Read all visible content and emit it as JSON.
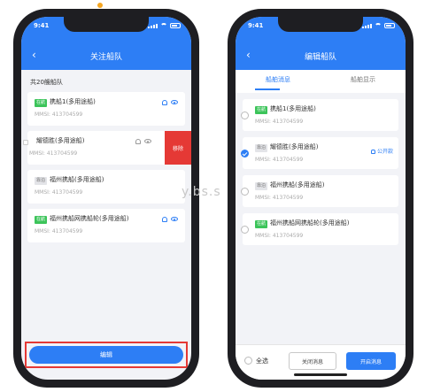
{
  "watermark": "y.bs.s",
  "left_phone": {
    "time": "9:41",
    "title": "关注船队",
    "count_text": "共20艘船队",
    "vessels": [
      {
        "tag": "在航",
        "tag_color": "green",
        "name": "携船1(多用途船)",
        "mmsi": "MMSI: 413704599"
      },
      {
        "tag": "",
        "tag_color": "box",
        "name": "耀德胜(多用途船)",
        "mmsi": "MMSI: 413704599",
        "action": "移除"
      },
      {
        "tag": "靠泊",
        "tag_color": "gray",
        "name": "福州携船(多用途船)",
        "mmsi": "MMSI: 413704599"
      },
      {
        "tag": "在航",
        "tag_color": "green",
        "name": "福州携船网携船轮(多用途船)",
        "mmsi": "MMSI: 413704599"
      }
    ],
    "edit_button": "编辑"
  },
  "right_phone": {
    "time": "9:41",
    "title": "编辑船队",
    "tabs": [
      "船舶消息",
      "船舶显示"
    ],
    "active_tab": 0,
    "vessels": [
      {
        "tag": "在航",
        "tag_color": "green",
        "name": "携船1(多用途船)",
        "mmsi": "MMSI: 413704599",
        "checked": false
      },
      {
        "tag": "靠泊",
        "tag_color": "gray",
        "name": "耀德胜(多用途船)",
        "mmsi": "MMSI: 413704599",
        "checked": true,
        "badge": "公开款"
      },
      {
        "tag": "靠泊",
        "tag_color": "gray",
        "name": "福州携船(多用途船)",
        "mmsi": "MMSI: 413704599",
        "checked": false
      },
      {
        "tag": "在航",
        "tag_color": "green",
        "name": "福州携船网携船轮(多用途船)",
        "mmsi": "MMSI: 413704599",
        "checked": false
      }
    ],
    "select_all": "全选",
    "close_msg": "关闭消息",
    "open_msg": "开启消息"
  },
  "colors": {
    "primary": "#2d7ef5",
    "danger": "#e53935",
    "sailing": "#3cc45a"
  }
}
